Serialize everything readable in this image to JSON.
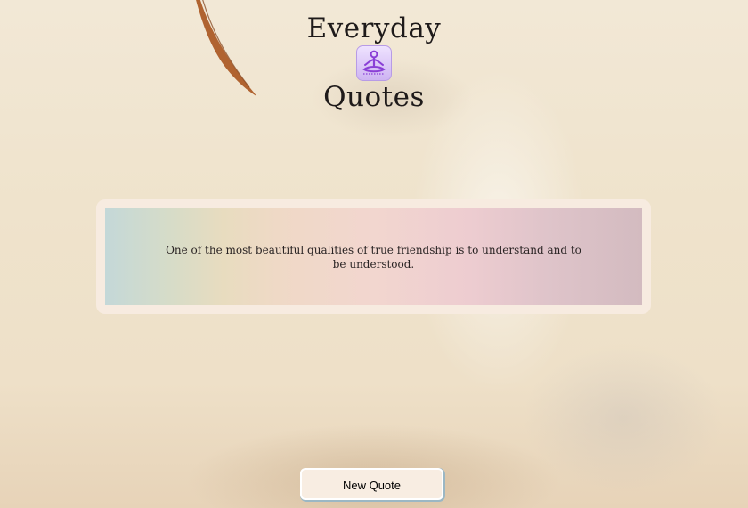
{
  "header": {
    "title_line1": "Everyday",
    "title_line2": "Quotes",
    "logo_icon": "meditation-icon"
  },
  "quote": {
    "text": "One of the most beautiful qualities of true friendship is to understand and to be understood."
  },
  "actions": {
    "new_quote_label": "New Quote"
  },
  "colors": {
    "logo_accent": "#8a3fd6",
    "frame": "#f7ebe0",
    "button_bg": "#f8ede2"
  }
}
